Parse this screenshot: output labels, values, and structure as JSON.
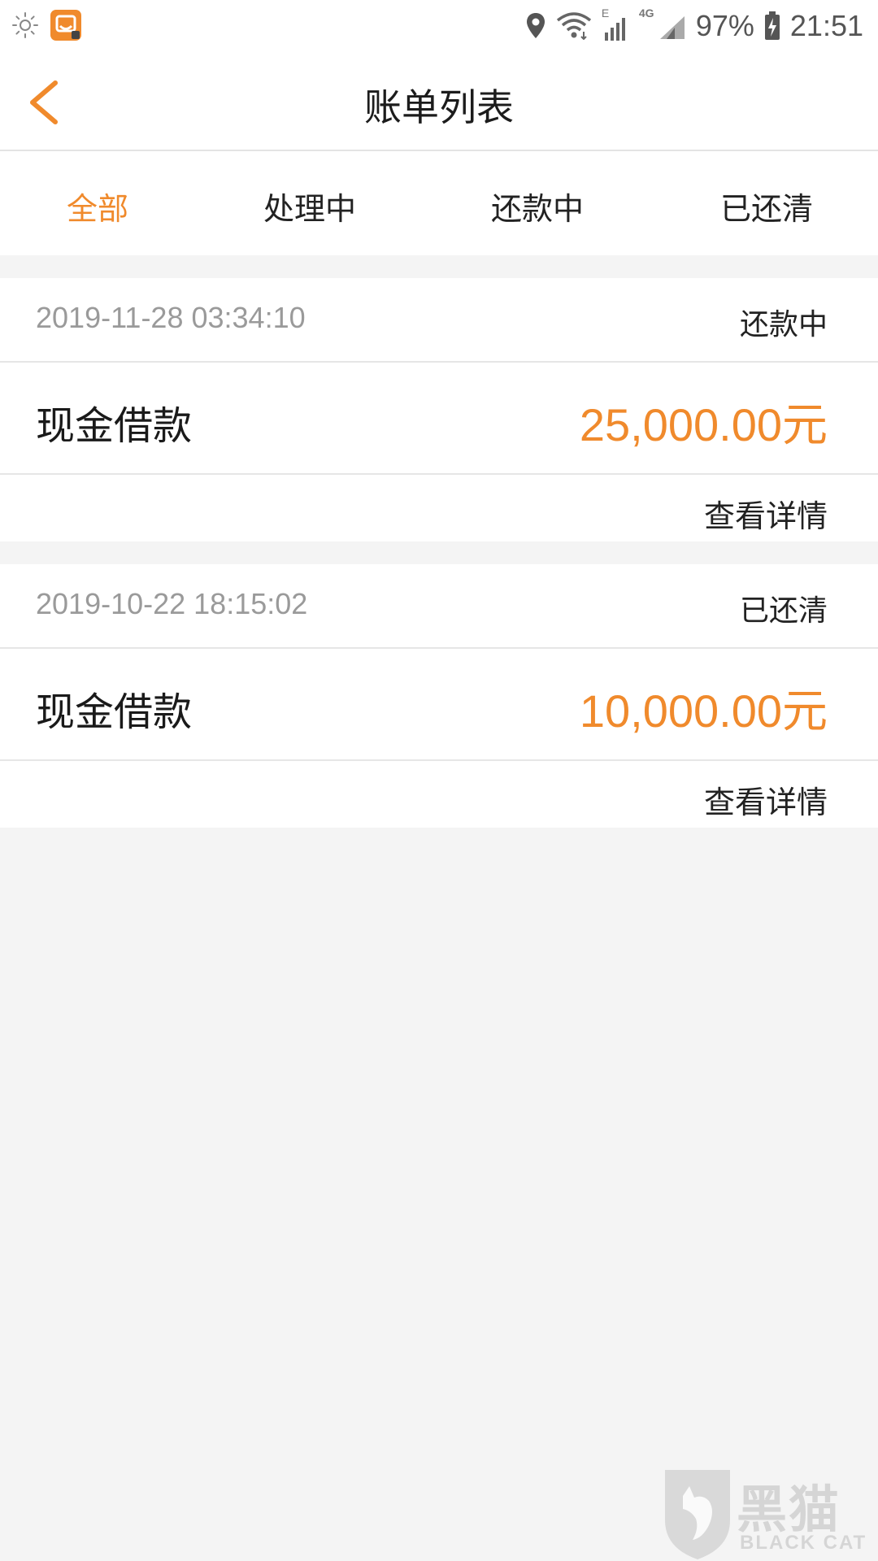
{
  "status_bar": {
    "network_labels": [
      "E",
      "4G"
    ],
    "battery": "97%",
    "time": "21:51"
  },
  "header": {
    "title": "账单列表"
  },
  "tabs": [
    {
      "label": "全部",
      "active": true
    },
    {
      "label": "处理中",
      "active": false
    },
    {
      "label": "还款中",
      "active": false
    },
    {
      "label": "已还清",
      "active": false
    }
  ],
  "bills": [
    {
      "datetime": "2019-11-28 03:34:10",
      "status": "还款中",
      "type": "现金借款",
      "amount": "25,000.00元",
      "detail_label": "查看详情"
    },
    {
      "datetime": "2019-10-22 18:15:02",
      "status": "已还清",
      "type": "现金借款",
      "amount": "10,000.00元",
      "detail_label": "查看详情"
    }
  ],
  "watermark": {
    "title": "黑猫",
    "subtitle": "BLACK CAT"
  },
  "colors": {
    "accent": "#f08a2c",
    "background": "#f4f4f4",
    "muted_text": "#9a9a9a"
  },
  "icons": {
    "back": "chevron-left-icon",
    "brightness": "sun-icon",
    "app": "didi-app-icon",
    "location": "location-pin-icon",
    "wifi": "wifi-icon",
    "signal": "signal-icon",
    "battery": "battery-charging-icon"
  }
}
